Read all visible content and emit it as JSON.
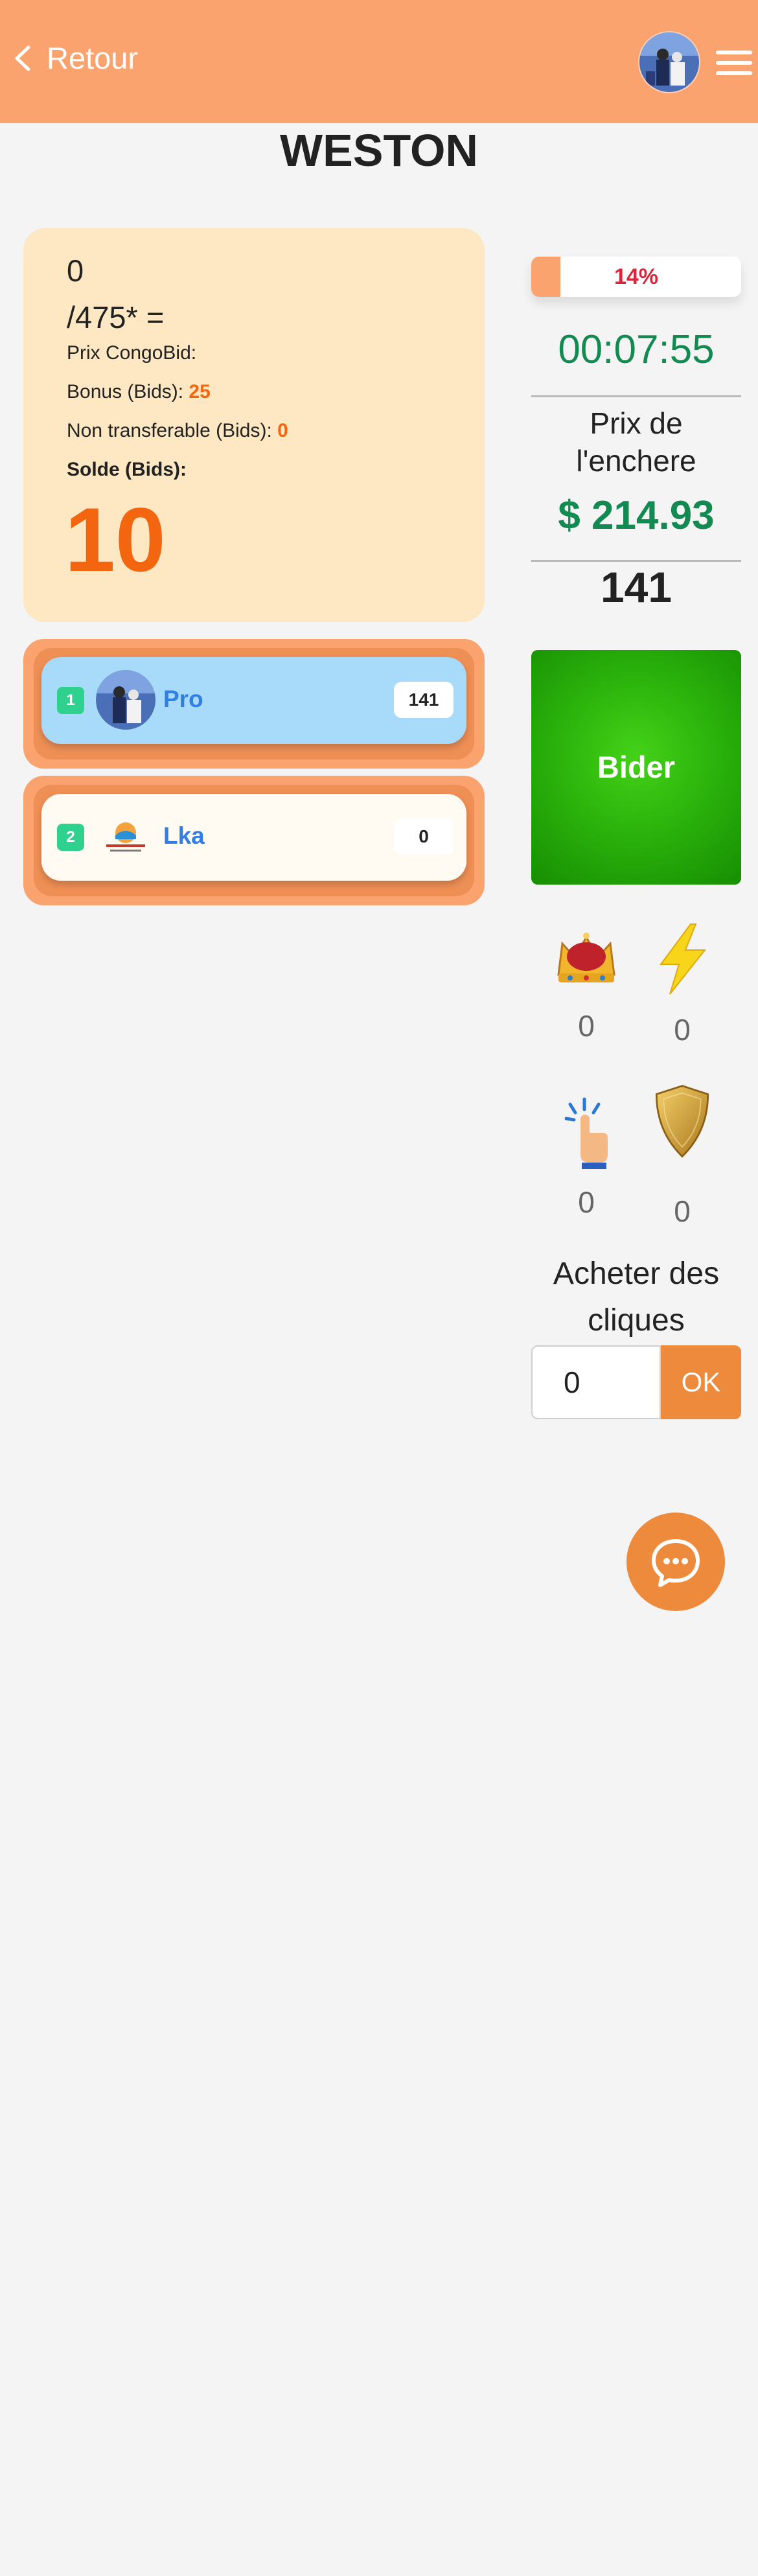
{
  "header": {
    "back_label": "Retour",
    "colors": {
      "bar": "#fba36e"
    }
  },
  "page_title": "WESTON",
  "info_card": {
    "current": "0",
    "total": "/475* =",
    "prix_label": "Prix CongoBid:",
    "bonus_label": "Bonus (Bids): ",
    "bonus_value": "25",
    "non_transferable_label": "Non transferable (Bids): ",
    "non_transferable_value": "0",
    "solde_label": "Solde (Bids):",
    "solde_value": "10"
  },
  "players": [
    {
      "rank": "1",
      "name": "Pro",
      "score": "141",
      "avatar": "user-photo"
    },
    {
      "rank": "2",
      "name": "Lka",
      "score": "0",
      "avatar": "company-logo"
    }
  ],
  "auction": {
    "progress_percent": 14,
    "progress_label": "14%",
    "timer": "00:07:55",
    "prix_label": "Prix de l'enchere",
    "price": "$ 214.93",
    "bid_count": "141",
    "bider_label": "Bider",
    "accent_green": "#138a52"
  },
  "boosters": [
    {
      "icon": "crown-icon",
      "value": "0"
    },
    {
      "icon": "lightning-icon",
      "value": "0"
    },
    {
      "icon": "tap-hand-icon",
      "value": "0"
    },
    {
      "icon": "shield-icon",
      "value": "0"
    }
  ],
  "buy_clicks": {
    "label": "Acheter des cliques",
    "input_value": "0",
    "ok_label": "OK"
  },
  "chat": {
    "icon": "chat-bubble-icon"
  }
}
